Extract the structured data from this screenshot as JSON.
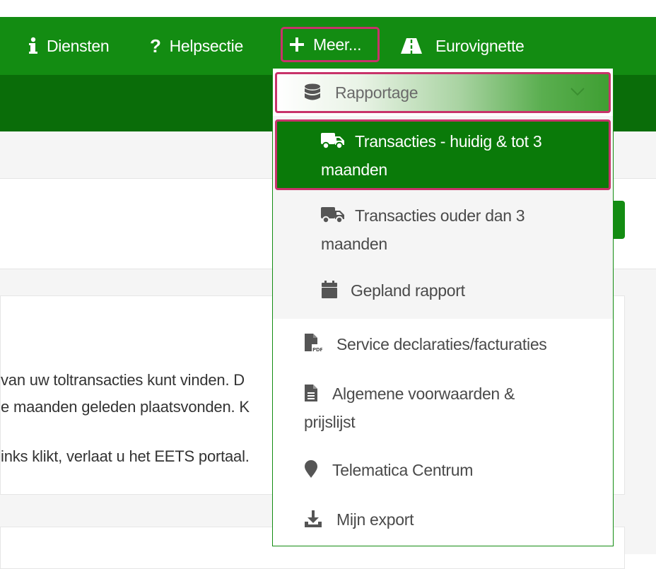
{
  "nav": {
    "items": [
      {
        "label": "Diensten",
        "icon": "info-icon"
      },
      {
        "label": "Helpsectie",
        "icon": "question-icon"
      },
      {
        "label": "Meer...",
        "icon": "plus-icon"
      },
      {
        "label": "Eurovignette",
        "icon": "road-icon"
      }
    ]
  },
  "dropdown": {
    "header": {
      "label": "Rapportage",
      "icon": "database-icon"
    },
    "sub_items": [
      {
        "line1": "Transacties - huidig & tot 3",
        "line2": "maanden",
        "icon": "truck-icon"
      },
      {
        "line1": "Transacties ouder dan 3",
        "line2": "maanden",
        "icon": "truck-icon"
      },
      {
        "label": "Gepland rapport",
        "icon": "calendar-icon"
      }
    ],
    "items": [
      {
        "label": "Service declaraties/facturaties",
        "icon": "pdf-file-icon"
      },
      {
        "line1": "Algemene voorwaarden &",
        "line2": "prijslijst",
        "icon": "document-icon"
      },
      {
        "label": "Telematica Centrum",
        "icon": "map-marker-icon"
      },
      {
        "label": "Mijn export",
        "icon": "download-icon"
      }
    ]
  },
  "page": {
    "text_lines": [
      "van uw toltransacties kunt vinden. D",
      "e maanden geleden plaatsvonden. K",
      "inks klikt, verlaat u het EETS portaal."
    ]
  },
  "colors": {
    "nav_green": "#138c12",
    "subbar_green": "#0a6d09",
    "active_green": "#0a7a09",
    "highlight_border": "#c8336a"
  }
}
